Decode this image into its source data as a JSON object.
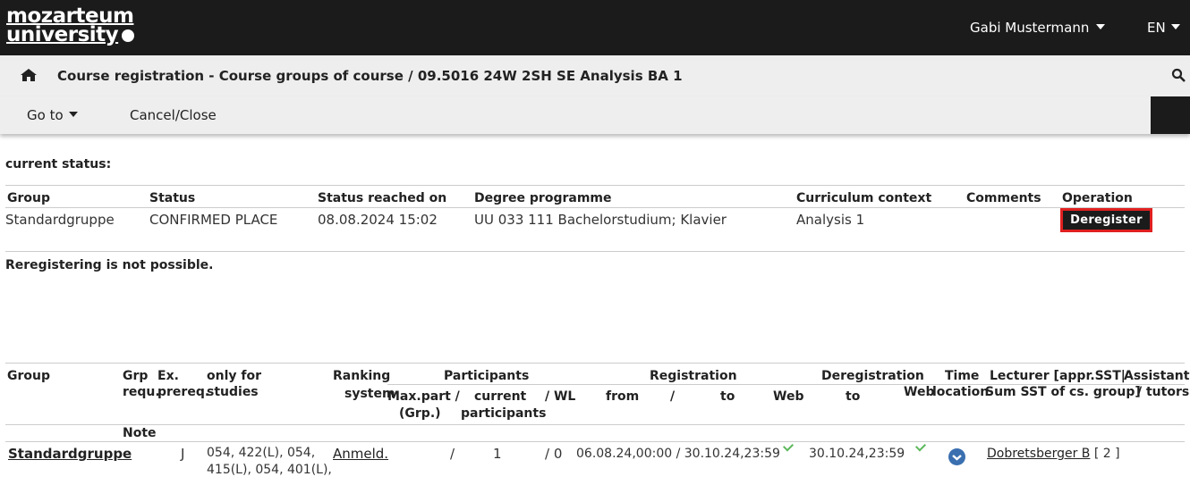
{
  "header": {
    "logo_line1": "mozarteum",
    "logo_line2": "university",
    "user_name": "Gabi Mustermann",
    "language": "EN"
  },
  "breadcrumb": {
    "title": "Course registration - Course groups of course  / 09.5016 24W 2SH SE Analysis BA 1"
  },
  "actions": {
    "goto_label": "Go to",
    "cancel_label": "Cancel/Close"
  },
  "status_section": {
    "heading": "current status:",
    "columns": [
      "Group",
      "Status",
      "Status reached on",
      "Degree programme",
      "Curriculum context",
      "Comments",
      "Operation"
    ],
    "row": {
      "group": "Standardgruppe",
      "status": "CONFIRMED PLACE",
      "reached_on": "08.08.2024 15:02",
      "degree": "UU 033 111 Bachelorstudium; Klavier",
      "curriculum": "Analysis 1",
      "comments": "",
      "operation_label": "Deregister"
    },
    "note": "Reregistering is not possible."
  },
  "groups_table": {
    "headers": {
      "group": "Group",
      "grp_requ_1": "Grp",
      "grp_requ_2": "requ.",
      "ex_prereq_1": "Ex.",
      "ex_prereq_2": "prereq.",
      "only_for_1": "only for",
      "only_for_2": "studies",
      "ranking_1": "Ranking",
      "ranking_2": "system",
      "participants": "Participants",
      "maxpart_1": "Max.part /",
      "maxpart_2": "(Grp.)",
      "current_1": "current",
      "current_2": "participants",
      "wl": "/ WL",
      "registration": "Registration",
      "reg_from": "from",
      "reg_slash": "/",
      "reg_to": "to",
      "reg_web": "Web",
      "deregistration": "Deregistration",
      "dereg_to": "to",
      "dereg_web": "Web",
      "time_1": "Time",
      "time_2": "location",
      "lecturer_1": "Lecturer [appr.SST|",
      "lecturer_2": "Sum SST of cs. group]",
      "assistants_1": "Assistants",
      "assistants_2": "/ tutors",
      "note": "Note"
    },
    "row": {
      "group": "Standardgruppe",
      "ex_prereq": "J",
      "only_for_line1": "054, 422(L), 054,",
      "only_for_line2": "415(L), 054, 401(L),",
      "ranking": "Anmeld.",
      "max_part": "/",
      "current": "1",
      "wl": "/  0",
      "registration": "06.08.24,00:00 / 30.10.24,23:59",
      "deregistration_to": "30.10.24,23:59",
      "lecturer": "Dobretsberger B",
      "lecturer_sst": "[ 2 ]"
    }
  },
  "colors": {
    "topbar": "#1b1b1b",
    "bar_bg": "#eeeeee",
    "deregister_border": "#e02020",
    "check": "#5cb85c",
    "time_icon": "#3a6fb0"
  },
  "icons": [
    "home-icon",
    "search-icon",
    "chevron-down-icon",
    "check-icon",
    "time-location-icon"
  ]
}
